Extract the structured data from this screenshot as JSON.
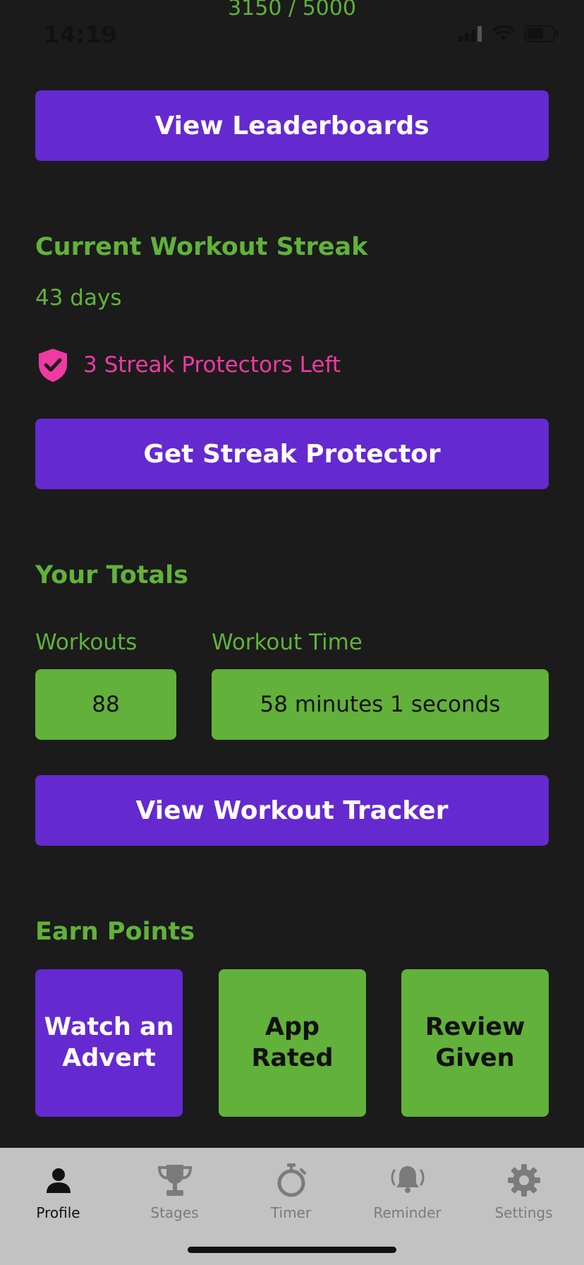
{
  "status_bar": {
    "points_progress": "3150 / 5000",
    "time": "14:19",
    "icons": [
      "signal-icon",
      "wifi-icon",
      "battery-icon"
    ]
  },
  "leaderboards_button": "View Leaderboards",
  "streak": {
    "heading": "Current Workout Streak",
    "days": "43 days",
    "protector_icon": "shield-check-icon",
    "protectors_left": "3 Streak Protectors Left",
    "get_protector_button": "Get Streak Protector"
  },
  "totals": {
    "heading": "Your Totals",
    "workouts_label": "Workouts",
    "workouts_value": "88",
    "time_label": "Workout Time",
    "time_value": "58 minutes 1 seconds",
    "tracker_button": "View Workout Tracker"
  },
  "earn": {
    "heading": "Earn Points",
    "tiles": [
      {
        "label": "Watch an Advert",
        "state": "available"
      },
      {
        "label": "App Rated",
        "state": "done"
      },
      {
        "label": "Review Given",
        "state": "done"
      }
    ]
  },
  "tabbar": {
    "tabs": [
      {
        "label": "Profile",
        "icon": "person-icon",
        "active": true
      },
      {
        "label": "Stages",
        "icon": "trophy-icon",
        "active": false
      },
      {
        "label": "Timer",
        "icon": "stopwatch-icon",
        "active": false
      },
      {
        "label": "Reminder",
        "icon": "bell-icon",
        "active": false
      },
      {
        "label": "Settings",
        "icon": "gear-icon",
        "active": false
      }
    ]
  },
  "colors": {
    "background": "#1b1b1b",
    "purple": "#6529d0",
    "green": "#62b13a",
    "pink": "#ef3aa2",
    "tabbar": "#c2c2c2"
  }
}
